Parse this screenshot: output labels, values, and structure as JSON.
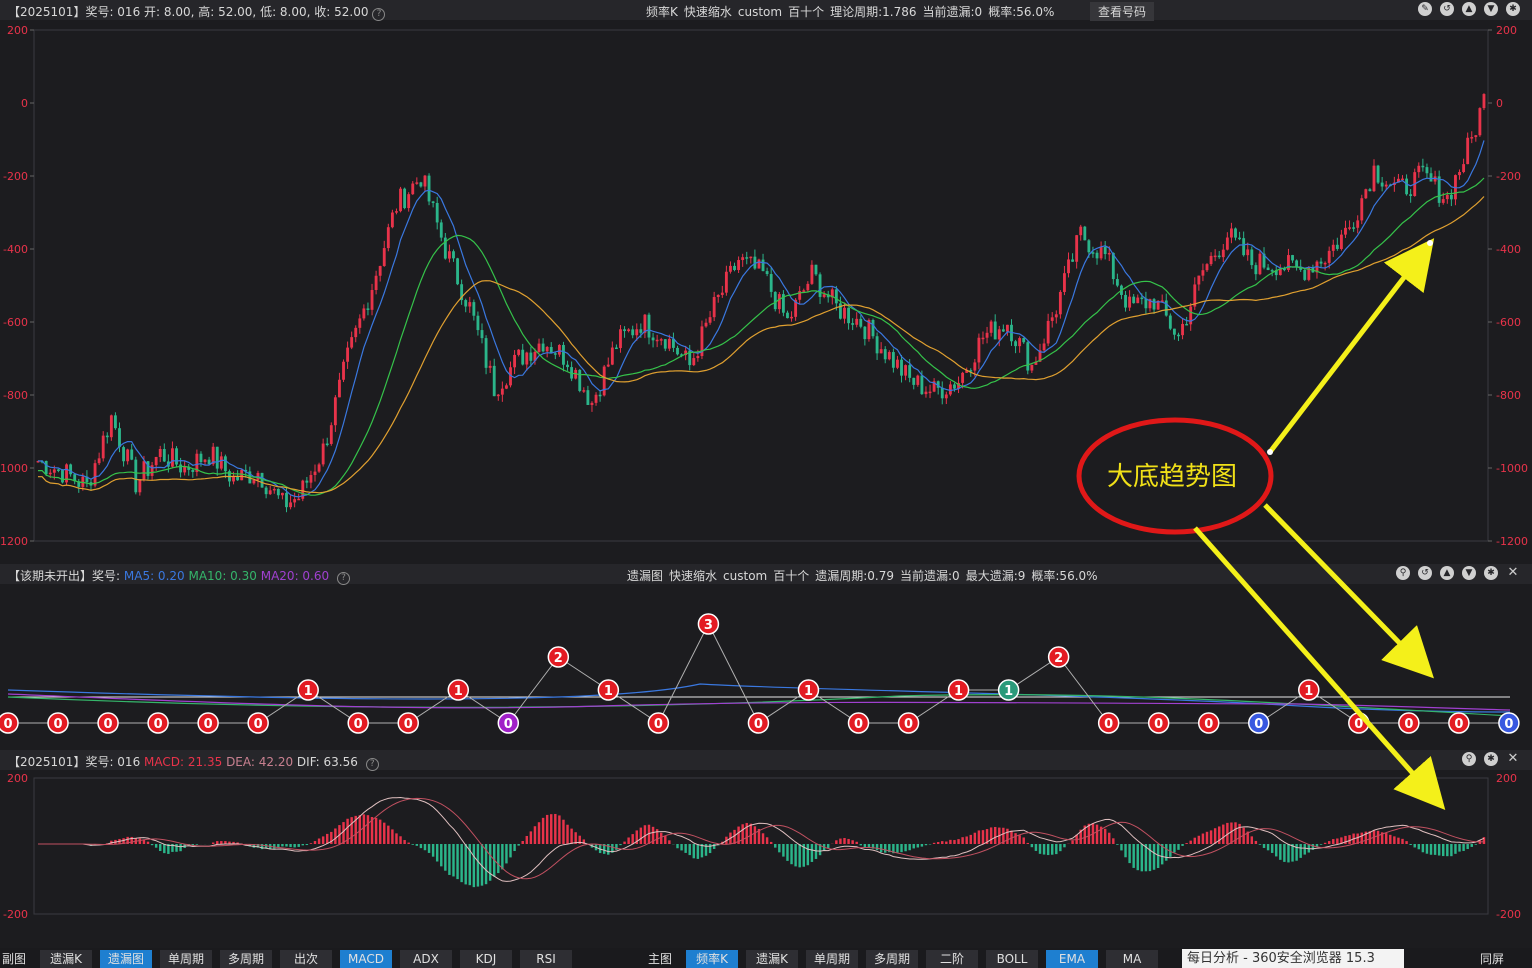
{
  "main_header": {
    "info": "【2025101】奖号: 016  开: 8.00, 高: 52.00, 低: 8.00, 收: 52.00",
    "center": [
      "频率K",
      "快速缩水",
      "custom",
      "百十个",
      "理论周期:1.786",
      "当前遗漏:0",
      "概率:56.0%"
    ],
    "button": "查看号码"
  },
  "miss_header": {
    "prefix": "【该期未开出】奖号:",
    "ma5": "MA5: 0.20",
    "ma10": "MA10: 0.30",
    "ma20": "MA20: 0.60",
    "center": [
      "遗漏图",
      "快速缩水",
      "custom",
      "百十个",
      "遗漏周期:0.79",
      "当前遗漏:0",
      "最大遗漏:9",
      "概率:56.0%"
    ]
  },
  "macd_header": {
    "prefix": "【2025101】奖号: 016",
    "macd": "MACD: 21.35",
    "dea": "DEA: 42.20",
    "dif": "DIF: 63.56"
  },
  "annotation": {
    "text": "大底趋势图"
  },
  "left_tabs": [
    {
      "label": "副图",
      "active": false,
      "plain": true
    },
    {
      "label": "遗漏K",
      "active": false
    },
    {
      "label": "遗漏图",
      "active": true
    },
    {
      "label": "单周期",
      "active": false
    },
    {
      "label": "多周期",
      "active": false
    },
    {
      "label": "出次",
      "active": false
    },
    {
      "label": "MACD",
      "active": true
    },
    {
      "label": "ADX",
      "active": false
    },
    {
      "label": "KDJ",
      "active": false
    },
    {
      "label": "RSI",
      "active": false
    }
  ],
  "right_tabs": [
    {
      "label": "主图",
      "active": false,
      "plain": true
    },
    {
      "label": "频率K",
      "active": true
    },
    {
      "label": "遗漏K",
      "active": false
    },
    {
      "label": "单周期",
      "active": false
    },
    {
      "label": "多周期",
      "active": false
    },
    {
      "label": "二阶",
      "active": false
    },
    {
      "label": "BOLL",
      "active": false
    },
    {
      "label": "EMA",
      "active": true
    },
    {
      "label": "MA",
      "active": false
    }
  ],
  "browser_tab": "每日分析 - 360安全浏览器 15.3",
  "fullscreen_btn": "同屏",
  "colors": {
    "up": "#e8334a",
    "down": "#2bb58a",
    "ma_blue": "#3a78e0",
    "ma_green": "#35c24a",
    "ma_orange": "#e0a030",
    "annotation": "#e01818",
    "arrow": "#f4f01a"
  },
  "chart_data": [
    {
      "type": "candlestick",
      "panel": "main",
      "ylim": [
        -1200,
        200
      ],
      "yticks": [
        200,
        0,
        -200,
        -400,
        -600,
        -800,
        -1000,
        -1200
      ],
      "close_anchors": [
        [
          0,
          -980
        ],
        [
          6,
          -1010
        ],
        [
          12,
          -1050
        ],
        [
          18,
          -860
        ],
        [
          24,
          -1040
        ],
        [
          30,
          -960
        ],
        [
          36,
          -1000
        ],
        [
          42,
          -960
        ],
        [
          48,
          -1030
        ],
        [
          54,
          -1010
        ],
        [
          60,
          -1100
        ],
        [
          64,
          -1080
        ],
        [
          70,
          -950
        ],
        [
          76,
          -700
        ],
        [
          82,
          -500
        ],
        [
          88,
          -280
        ],
        [
          94,
          -200
        ],
        [
          100,
          -400
        ],
        [
          106,
          -560
        ],
        [
          112,
          -780
        ],
        [
          118,
          -700
        ],
        [
          124,
          -650
        ],
        [
          130,
          -700
        ],
        [
          136,
          -820
        ],
        [
          142,
          -660
        ],
        [
          148,
          -600
        ],
        [
          154,
          -640
        ],
        [
          160,
          -720
        ],
        [
          166,
          -560
        ],
        [
          172,
          -430
        ],
        [
          178,
          -470
        ],
        [
          184,
          -600
        ],
        [
          190,
          -470
        ],
        [
          196,
          -560
        ],
        [
          202,
          -600
        ],
        [
          208,
          -680
        ],
        [
          214,
          -760
        ],
        [
          220,
          -790
        ],
        [
          226,
          -760
        ],
        [
          232,
          -640
        ],
        [
          238,
          -600
        ],
        [
          244,
          -720
        ],
        [
          250,
          -560
        ],
        [
          256,
          -360
        ],
        [
          262,
          -420
        ],
        [
          268,
          -560
        ],
        [
          274,
          -540
        ],
        [
          280,
          -640
        ],
        [
          286,
          -460
        ],
        [
          292,
          -360
        ],
        [
          298,
          -440
        ],
        [
          304,
          -440
        ],
        [
          310,
          -460
        ],
        [
          316,
          -420
        ],
        [
          322,
          -340
        ],
        [
          328,
          -180
        ],
        [
          334,
          -240
        ],
        [
          340,
          -200
        ],
        [
          346,
          -260
        ],
        [
          352,
          -100
        ],
        [
          355,
          10
        ]
      ]
    },
    {
      "type": "line",
      "panel": "miss",
      "points": [
        0,
        0,
        0,
        0,
        0,
        0,
        1,
        0,
        0,
        1,
        0,
        2,
        1,
        0,
        3,
        0,
        1,
        0,
        0,
        1,
        1,
        2,
        0,
        0,
        0,
        0,
        1,
        0,
        0,
        0,
        0
      ],
      "marker_colors": {
        "default": "#e31b23",
        "teal": "#2a9a7a",
        "purple": "#a020c8",
        "blue": "#3858e0"
      }
    },
    {
      "type": "histogram+line",
      "panel": "macd",
      "ylim": [
        -200,
        200
      ],
      "yticks": [
        200,
        -200
      ]
    }
  ]
}
